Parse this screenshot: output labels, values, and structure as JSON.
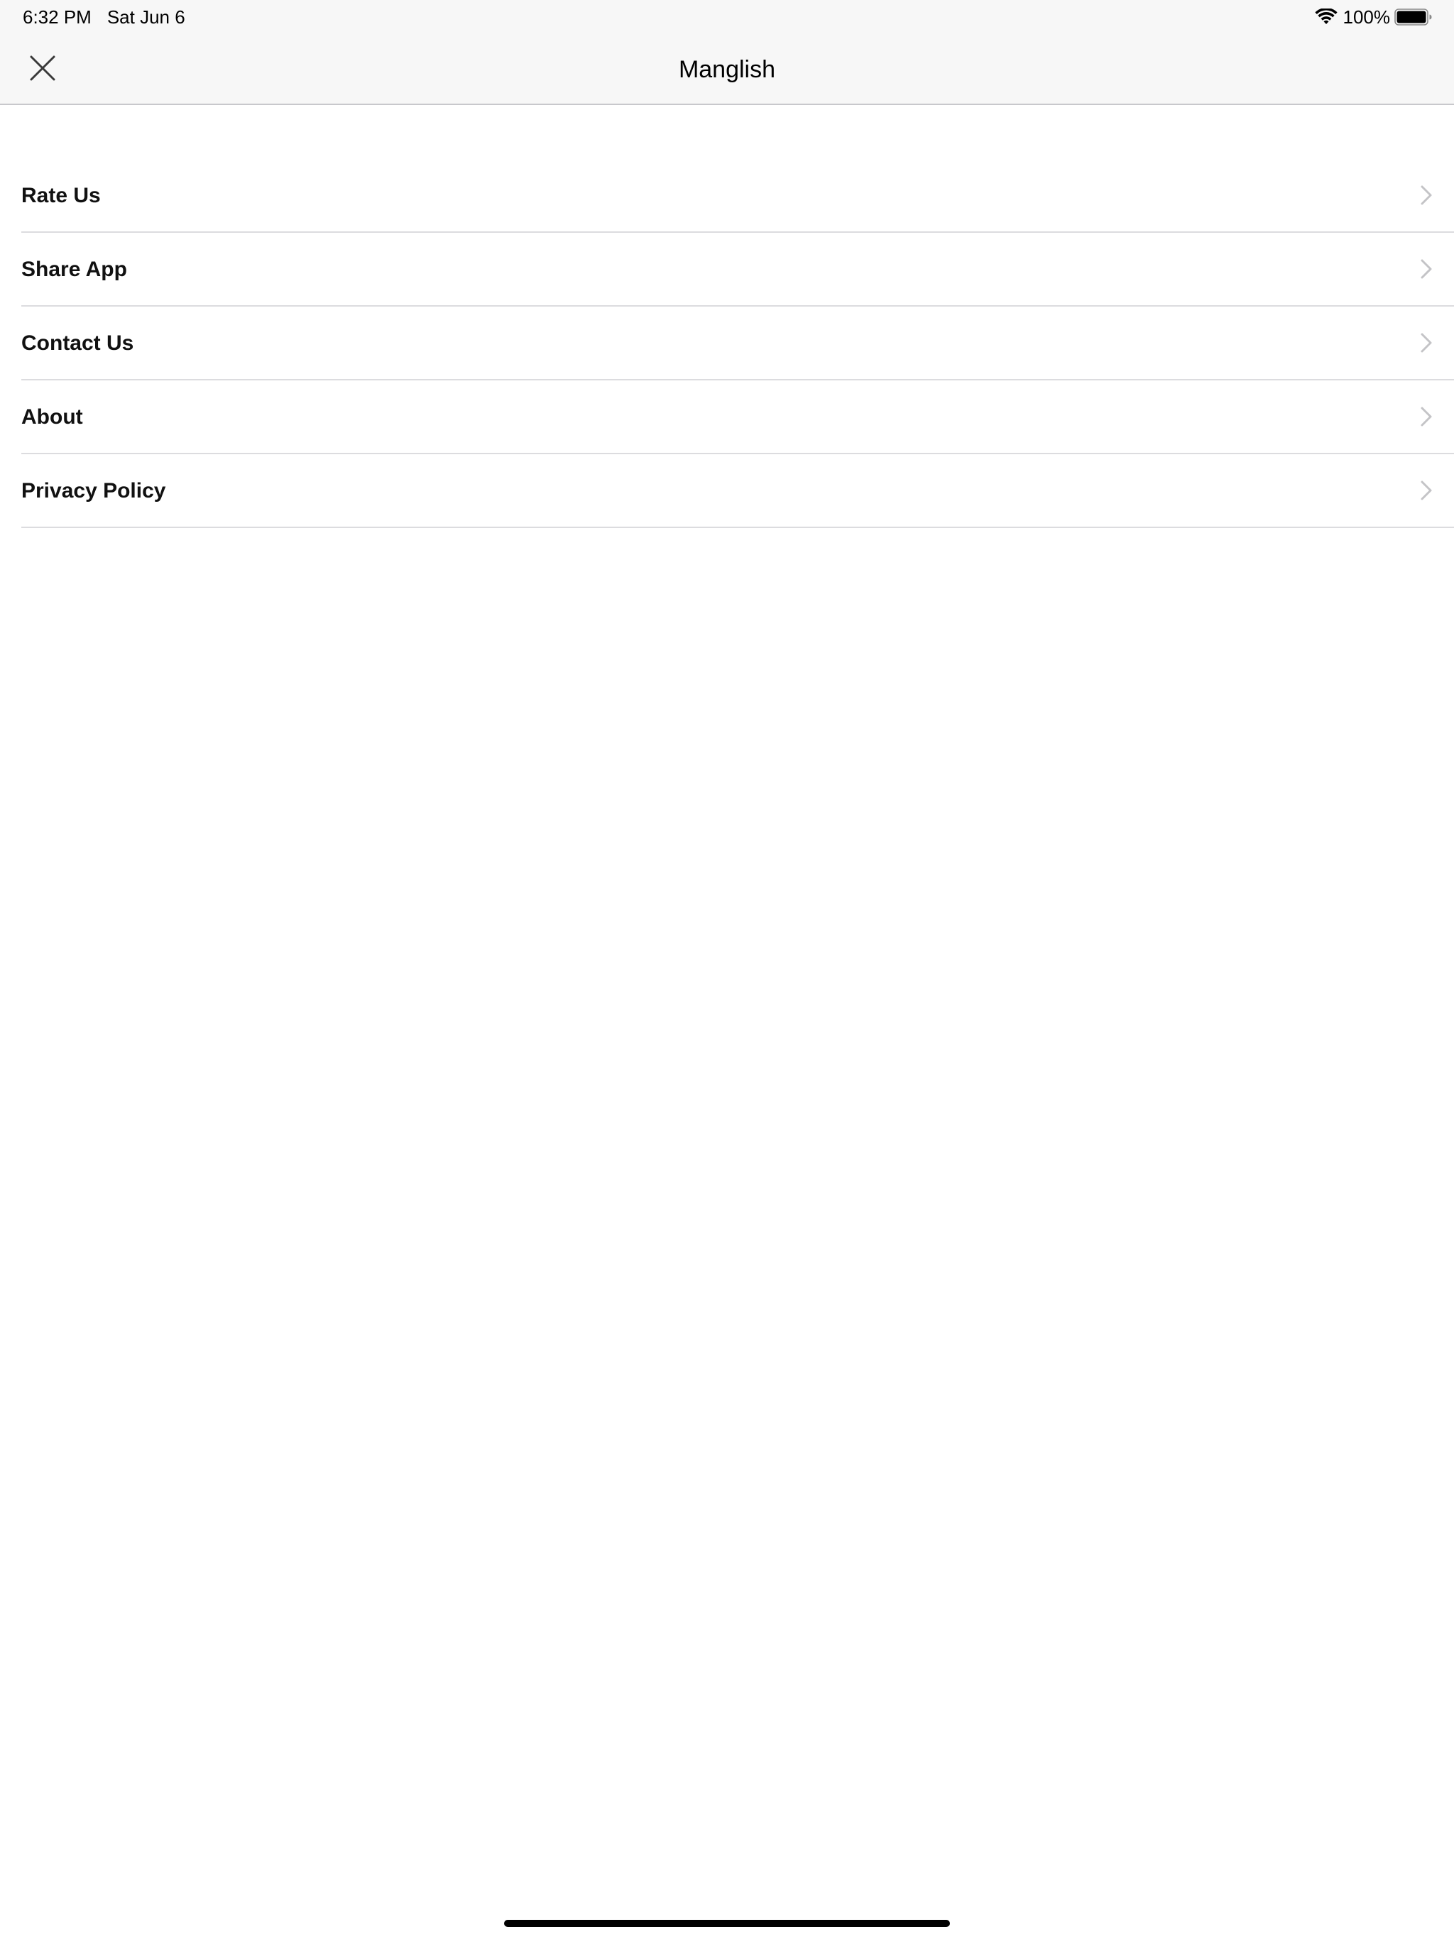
{
  "status_bar": {
    "time": "6:32 PM",
    "date": "Sat Jun 6",
    "battery_percent": "100%",
    "battery_level": 1.0
  },
  "nav": {
    "title": "Manglish",
    "close_icon": "close-icon"
  },
  "menu": {
    "items": [
      {
        "label": "Rate Us",
        "icon": "chevron-right-icon"
      },
      {
        "label": "Share App",
        "icon": "chevron-right-icon"
      },
      {
        "label": "Contact Us",
        "icon": "chevron-right-icon"
      },
      {
        "label": "About",
        "icon": "chevron-right-icon"
      },
      {
        "label": "Privacy Policy",
        "icon": "chevron-right-icon"
      }
    ]
  },
  "colors": {
    "bar_background": "#f7f7f7",
    "separator": "#dcdcdf",
    "chevron": "#c4c4c7",
    "text": "#111111"
  }
}
